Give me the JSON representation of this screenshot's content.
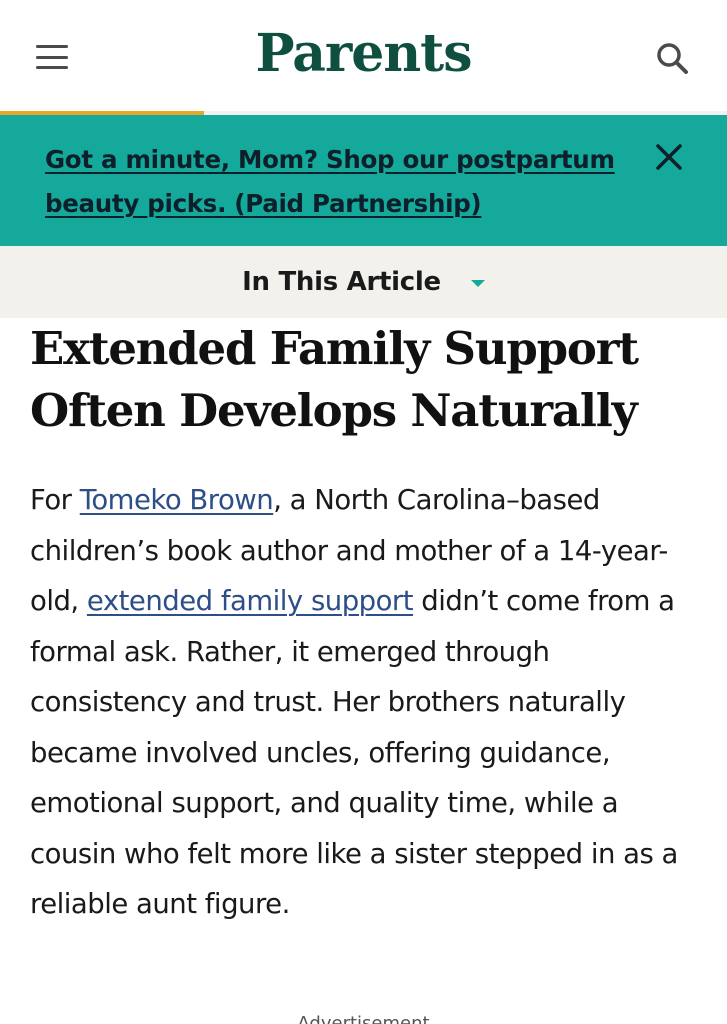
{
  "header": {
    "logo": "Parents",
    "menu_icon": "hamburger-menu-icon",
    "search_icon": "search-icon",
    "reading_progress": 0.28,
    "progress_color": "#e4a92a"
  },
  "promo": {
    "text": "Got a minute, Mom? Shop our postpartum beauty picks. (Paid Partnership)",
    "close_icon": "close-icon",
    "background": "#14a99a"
  },
  "toc": {
    "label": "In This Article",
    "caret_icon": "chevron-down-icon"
  },
  "article": {
    "heading": "Extended Family Support Often Develops Naturally",
    "paragraph": {
      "before_link1": "For ",
      "link1": "Tomeko Brown",
      "between_links": ", a North Carolina–based children’s book author and mother of a 14-year-old, ",
      "link2": "extended family support",
      "after_link2": " didn’t come from a formal ask. Rather, it emerged through consistency and trust. Her brothers naturally became involved uncles, offering guidance, emotional support, and quality time, while a cousin who felt more like a sister stepped in as a reliable aunt figure."
    },
    "link_color": "#2d4e86"
  },
  "advertisement_label": "Advertisement"
}
